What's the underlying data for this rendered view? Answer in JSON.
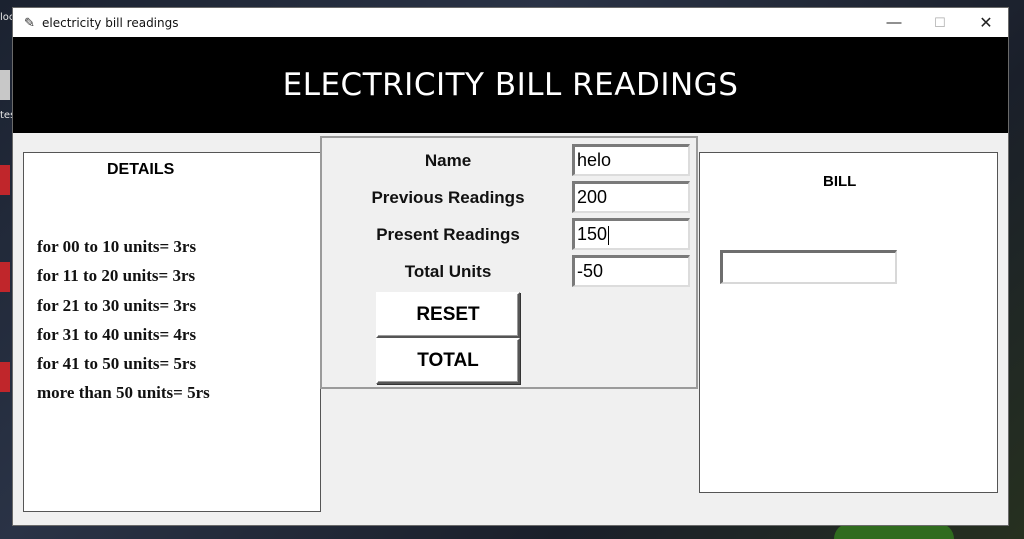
{
  "desktop": {
    "labels": [
      "loc",
      "tes"
    ]
  },
  "window": {
    "title": "electricity bill readings",
    "controls": {
      "minimize": "—",
      "maximize": "☐",
      "close": "✕"
    }
  },
  "banner": {
    "heading": "ELECTRICITY BILL READINGS"
  },
  "details": {
    "heading": "DETAILS",
    "rates": [
      "for 00 to 10 units= 3rs",
      "for 11 to 20 units= 3rs",
      "for 21 to 30 units= 3rs",
      "for 31 to 40 units= 4rs",
      "for 41 to 50 units= 5rs",
      "more than 50 units= 5rs"
    ]
  },
  "form": {
    "name_label": "Name",
    "name_value": "helo",
    "previous_label": "Previous Readings",
    "previous_value": "200",
    "present_label": "Present Readings",
    "present_value": "150",
    "total_units_label": "Total Units",
    "total_units_value": "-50",
    "reset_label": "RESET",
    "total_label": "TOTAL"
  },
  "bill": {
    "heading": "BILL",
    "value": ""
  },
  "colors": {
    "banner_bg": "#000000",
    "banner_text": "#ffffff",
    "window_bg": "#f0f0f0"
  }
}
